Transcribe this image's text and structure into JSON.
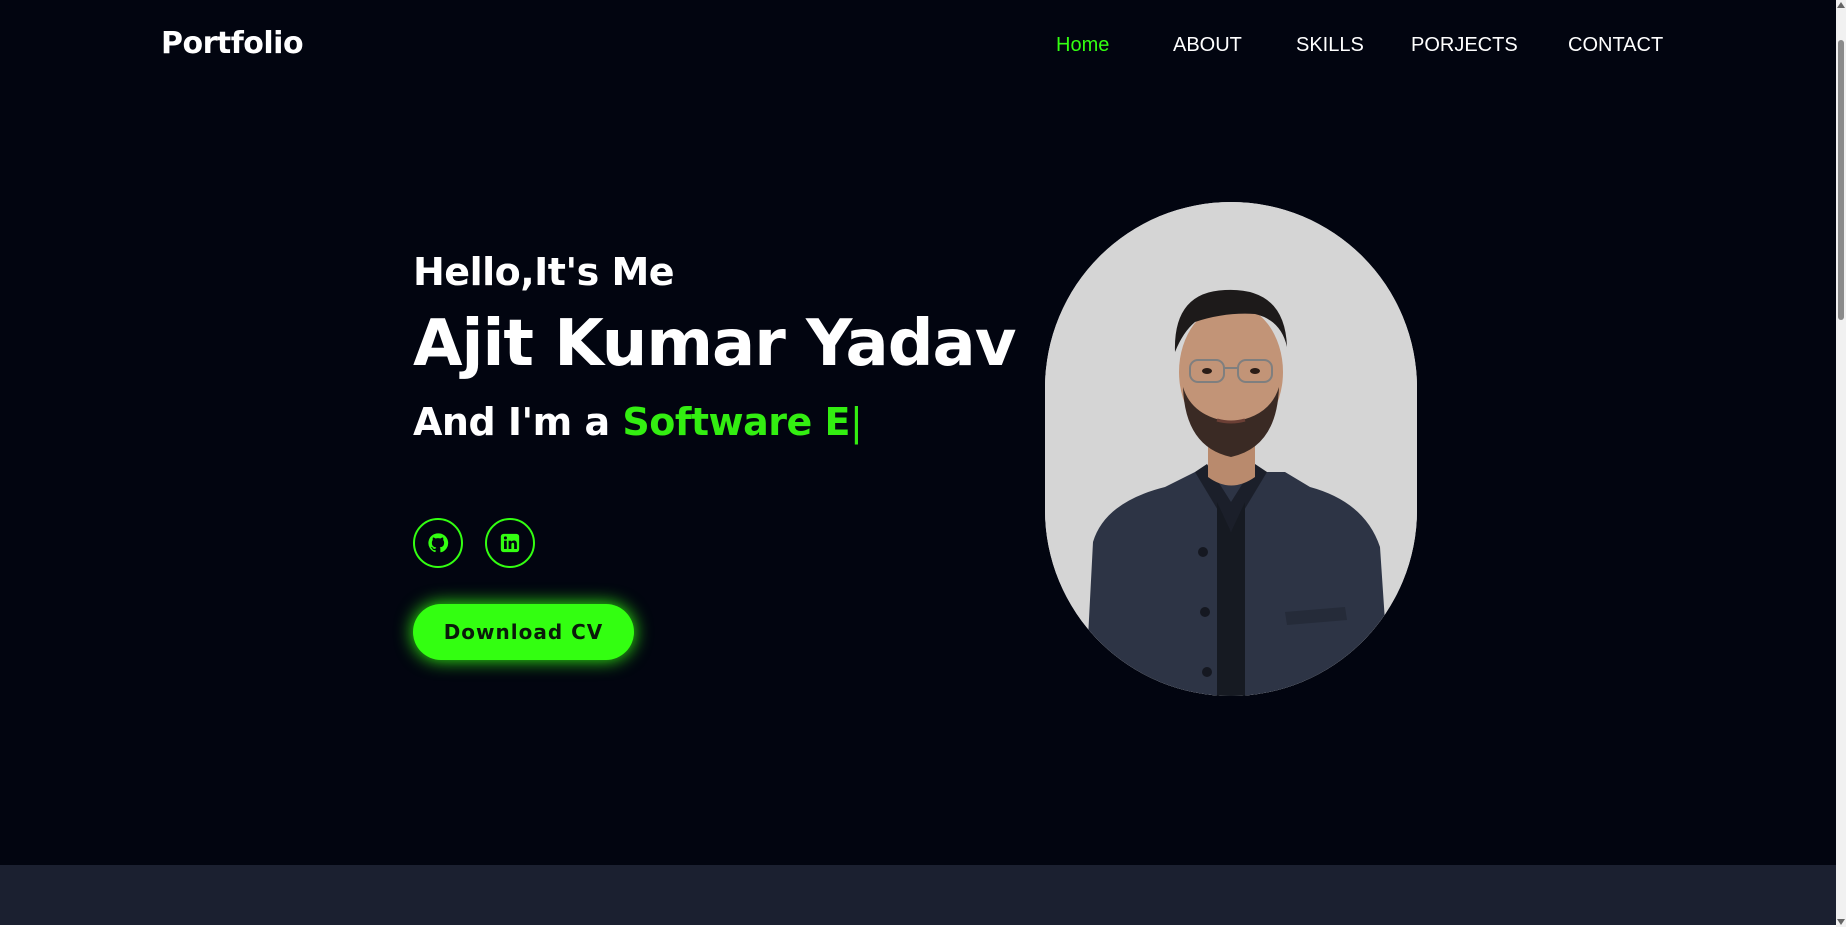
{
  "header": {
    "logo": "Portfolio",
    "nav": [
      {
        "label": "Home",
        "active": true
      },
      {
        "label": "ABOUT",
        "active": false
      },
      {
        "label": "SKILLS",
        "active": false
      },
      {
        "label": "PORJECTS",
        "active": false
      },
      {
        "label": "CONTACT",
        "active": false
      }
    ]
  },
  "hero": {
    "greeting": "Hello,It's Me",
    "name": "Ajit Kumar Yadav",
    "role_prefix": "And I'm a ",
    "role_typed": "Software E",
    "caret": "|",
    "social": [
      {
        "icon": "github-icon"
      },
      {
        "icon": "linkedin-icon"
      }
    ],
    "cv_button": "Download CV",
    "photo": {
      "description": "portrait-photo"
    }
  },
  "theme": {
    "background": "#020510",
    "accent": "#33ff11",
    "section_background": "#1b2030"
  }
}
